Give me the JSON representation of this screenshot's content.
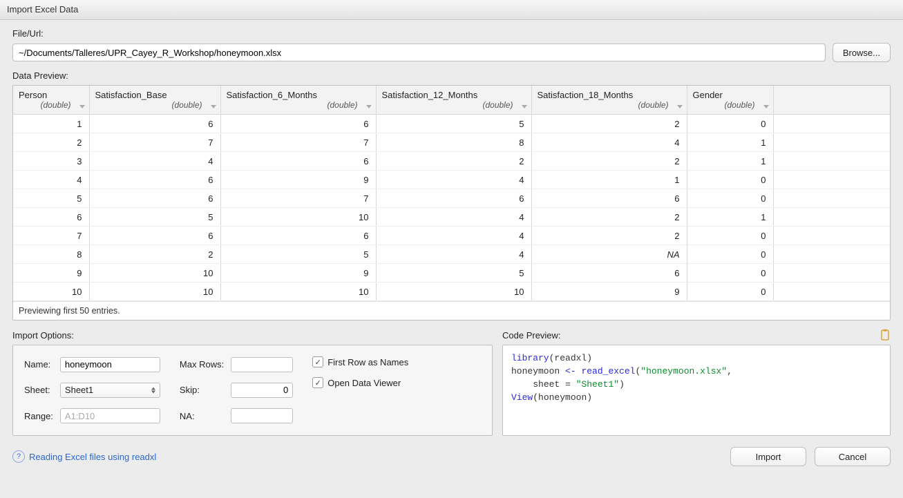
{
  "window": {
    "title": "Import Excel Data"
  },
  "file": {
    "label": "File/Url:",
    "value": "~/Documents/Talleres/UPR_Cayey_R_Workshop/honeymoon.xlsx",
    "browse_label": "Browse..."
  },
  "preview": {
    "label": "Data Preview:",
    "footer": "Previewing first 50 entries.",
    "columns": [
      {
        "name": "Person",
        "type": "(double)"
      },
      {
        "name": "Satisfaction_Base",
        "type": "(double)"
      },
      {
        "name": "Satisfaction_6_Months",
        "type": "(double)"
      },
      {
        "name": "Satisfaction_12_Months",
        "type": "(double)"
      },
      {
        "name": "Satisfaction_18_Months",
        "type": "(double)"
      },
      {
        "name": "Gender",
        "type": "(double)"
      }
    ],
    "rows": [
      [
        "1",
        "6",
        "6",
        "5",
        "2",
        "0"
      ],
      [
        "2",
        "7",
        "7",
        "8",
        "4",
        "1"
      ],
      [
        "3",
        "4",
        "6",
        "2",
        "2",
        "1"
      ],
      [
        "4",
        "6",
        "9",
        "4",
        "1",
        "0"
      ],
      [
        "5",
        "6",
        "7",
        "6",
        "6",
        "0"
      ],
      [
        "6",
        "5",
        "10",
        "4",
        "2",
        "1"
      ],
      [
        "7",
        "6",
        "6",
        "4",
        "2",
        "0"
      ],
      [
        "8",
        "2",
        "5",
        "4",
        "NA",
        "0"
      ],
      [
        "9",
        "10",
        "9",
        "5",
        "6",
        "0"
      ],
      [
        "10",
        "10",
        "10",
        "10",
        "9",
        "0"
      ]
    ]
  },
  "options": {
    "label": "Import Options:",
    "name_label": "Name:",
    "name_value": "honeymoon",
    "sheet_label": "Sheet:",
    "sheet_value": "Sheet1",
    "range_label": "Range:",
    "range_placeholder": "A1:D10",
    "maxrows_label": "Max Rows:",
    "maxrows_value": "",
    "skip_label": "Skip:",
    "skip_value": "0",
    "na_label": "NA:",
    "na_value": "",
    "first_row_label": "First Row as Names",
    "open_viewer_label": "Open Data Viewer"
  },
  "code": {
    "label": "Code Preview:",
    "lib_fn": "library",
    "lib_arg": "readxl",
    "var": "honeymoon",
    "assign": "<-",
    "read_fn": "read_excel",
    "file_str": "\"honeymoon.xlsx\"",
    "sheet_kw": "sheet",
    "sheet_str": "\"Sheet1\"",
    "view_fn": "View",
    "view_arg": "honeymoon"
  },
  "help": {
    "text": "Reading Excel files using readxl"
  },
  "footer": {
    "import_label": "Import",
    "cancel_label": "Cancel"
  }
}
